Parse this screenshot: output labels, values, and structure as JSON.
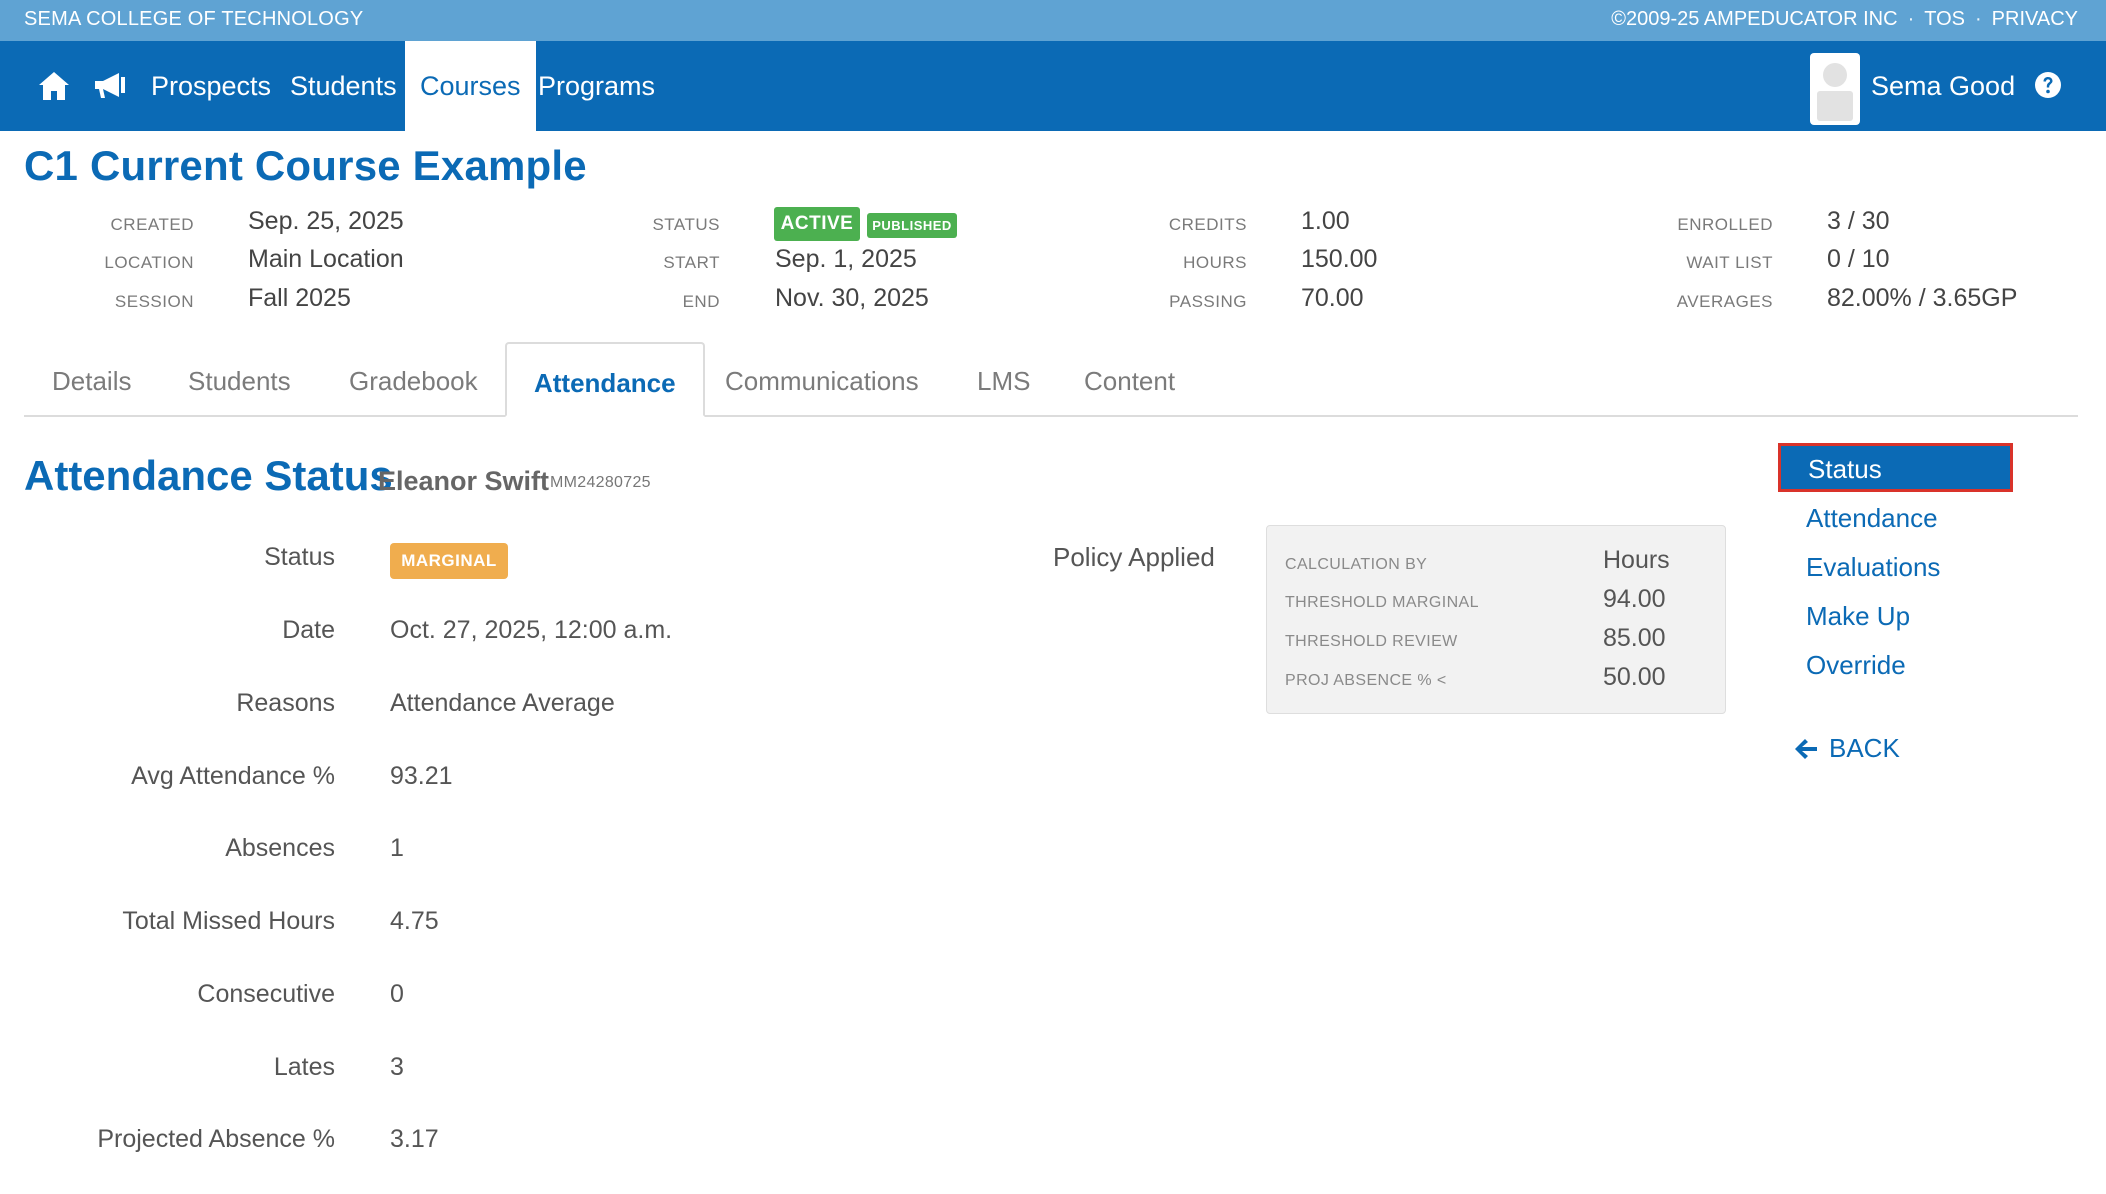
{
  "top_bar": {
    "org_name": "SEMA COLLEGE OF TECHNOLOGY",
    "copyright": "©2009-25 AMPEDUCATOR INC",
    "separator": "·",
    "tos_link": "TOS",
    "privacy_link": "PRIVACY"
  },
  "nav": {
    "items": [
      {
        "label": "Prospects"
      },
      {
        "label": "Students"
      },
      {
        "label": "Courses"
      },
      {
        "label": "Programs"
      }
    ],
    "active_item": "Courses",
    "user_name": "Sema Good",
    "icons": [
      "home-icon",
      "megaphone-icon",
      "avatar",
      "help-icon"
    ]
  },
  "course": {
    "title": "C1 Current Course Example",
    "created_label": "CREATED",
    "created": "Sep. 25, 2025",
    "location_label": "LOCATION",
    "location": "Main Location",
    "session_label": "SESSION",
    "session": "Fall 2025",
    "status_label": "STATUS",
    "status_badge": "ACTIVE",
    "published_badge": "PUBLISHED",
    "start_label": "START",
    "start": "Sep. 1, 2025",
    "end_label": "END",
    "end": "Nov. 30, 2025",
    "credits_label": "CREDITS",
    "credits": "1.00",
    "hours_label": "HOURS",
    "hours": "150.00",
    "passing_label": "PASSING",
    "passing": "70.00",
    "enrolled_label": "ENROLLED",
    "enrolled": "3 / 30",
    "waitlist_label": "WAIT LIST",
    "waitlist": "0 / 10",
    "averages_label": "AVERAGES",
    "averages": "82.00% / 3.65GP"
  },
  "tabs": [
    {
      "label": "Details"
    },
    {
      "label": "Students"
    },
    {
      "label": "Gradebook"
    },
    {
      "label": "Attendance"
    },
    {
      "label": "Communications"
    },
    {
      "label": "LMS"
    },
    {
      "label": "Content"
    }
  ],
  "active_tab": "Attendance",
  "attendance_status": {
    "title": "Attendance Status",
    "student_name": "Eleanor Swift",
    "student_id": "MM24280725",
    "status_label": "Status",
    "status_badge": "MARGINAL",
    "rows": [
      {
        "label": "Date",
        "value": "Oct. 27, 2025, 12:00 a.m."
      },
      {
        "label": "Reasons",
        "value": "Attendance Average"
      },
      {
        "label": "Avg Attendance %",
        "value": "93.21"
      },
      {
        "label": "Absences",
        "value": "1"
      },
      {
        "label": "Total Missed Hours",
        "value": "4.75"
      },
      {
        "label": "Consecutive",
        "value": "0"
      },
      {
        "label": "Lates",
        "value": "3"
      },
      {
        "label": "Projected Absence %",
        "value": "3.17"
      }
    ]
  },
  "policy": {
    "label": "Policy Applied",
    "rows": [
      {
        "key": "CALCULATION BY",
        "value": "Hours"
      },
      {
        "key": "THRESHOLD MARGINAL",
        "value": "94.00"
      },
      {
        "key": "THRESHOLD REVIEW",
        "value": "85.00"
      },
      {
        "key": "PROJ ABSENCE % <",
        "value": "50.00"
      }
    ]
  },
  "side_menu": {
    "items": [
      {
        "label": "Status"
      },
      {
        "label": "Attendance"
      },
      {
        "label": "Evaluations"
      },
      {
        "label": "Make Up"
      },
      {
        "label": "Override"
      }
    ],
    "active_item": "Status",
    "back_label": "BACK"
  },
  "colors": {
    "primary": "#0b6ab5",
    "top_strip": "#5fa3d3",
    "active_badge": "#4cb050",
    "marginal_badge": "#f0ad4e",
    "highlight_border": "#d9332a"
  }
}
